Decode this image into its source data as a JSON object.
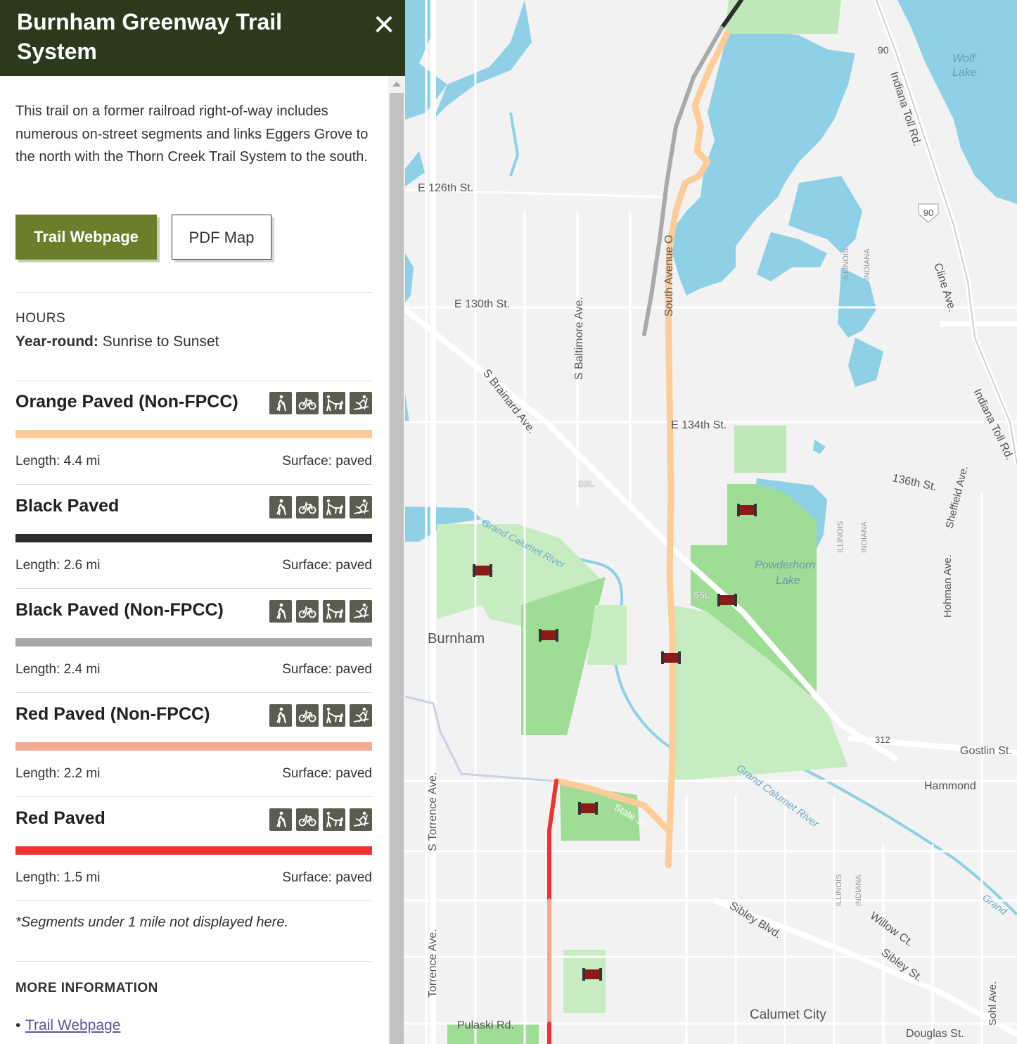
{
  "panel": {
    "title": "Burnham Greenway Trail System",
    "close_icon": "close-x-icon",
    "description": "This trail on a former railroad right-of-way includes numerous on-street segments and links Eggers Grove to the north with the Thorn Creek Trail System to the south.",
    "buttons": {
      "webpage": "Trail Webpage",
      "pdf": "PDF Map"
    },
    "hours": {
      "heading": "HOURS",
      "label": "Year-round:",
      "value": "Sunrise to Sunset"
    },
    "segments": [
      {
        "name": "Orange Paved (Non-FPCC)",
        "color": "#fdcc99",
        "length": "Length: 4.4 mi",
        "surface": "Surface: paved"
      },
      {
        "name": "Black Paved",
        "color": "#2d2d2d",
        "length": "Length: 2.6 mi",
        "surface": "Surface: paved"
      },
      {
        "name": "Black Paved (Non-FPCC)",
        "color": "#a9a9a9",
        "length": "Length: 2.4 mi",
        "surface": "Surface: paved"
      },
      {
        "name": "Red Paved (Non-FPCC)",
        "color": "#f4a992",
        "length": "Length: 2.2 mi",
        "surface": "Surface: paved"
      },
      {
        "name": "Red Paved",
        "color": "#ee3131",
        "length": "Length: 1.5 mi",
        "surface": "Surface: paved"
      }
    ],
    "activity_icons": [
      "hiking-icon",
      "bicycle-icon",
      "dog-walking-icon",
      "cross-country-ski-icon"
    ],
    "note": "*Segments under 1 mile not displayed here.",
    "more_info": {
      "heading": "MORE INFORMATION",
      "links": [
        "Trail Webpage"
      ]
    }
  },
  "map": {
    "labels": {
      "e126": "E 126th St.",
      "e130": "E 130th St.",
      "e134": "E 134th St.",
      "e136": "136th St.",
      "baltimore": "S Baltimore Ave.",
      "brainard": "S Brainard Ave.",
      "south_ave_o": "South Avenue O",
      "torrence_s": "S Torrence Ave.",
      "torrence": "Torrence Ave.",
      "pulaski": "Pulaski Rd.",
      "burnham": "Burnham",
      "calumet_river_1": "Grand Calumet River",
      "calumet_river_2": "Grand Calumet River",
      "grand": "Grand",
      "wolf_1": "Wolf",
      "wolf_2": "Lake",
      "powerhorn_1": "Powderhorn",
      "powerhorn_2": "Lake",
      "toll_1": "Indiana Toll Rd.",
      "toll_2": "Indiana Toll Rd.",
      "cline": "Cline Ave.",
      "sheffield": "Sheffield Ave.",
      "hohman": "Hohman Ave.",
      "gostlin": "Gostlin St.",
      "hammond": "Hammond",
      "sibley_blvd": "Sibley Blvd.",
      "willow": "Willow Ct.",
      "sibley_st": "Sibley St.",
      "calumet_city": "Calumet City",
      "douglas": "Douglas St.",
      "sohl": "Sohl Ave.",
      "illinois": "ILLINOIS",
      "indiana": "INDIANA",
      "rt90": "90",
      "rt312": "312",
      "ssl": "SSL",
      "state_st": "State St."
    }
  }
}
